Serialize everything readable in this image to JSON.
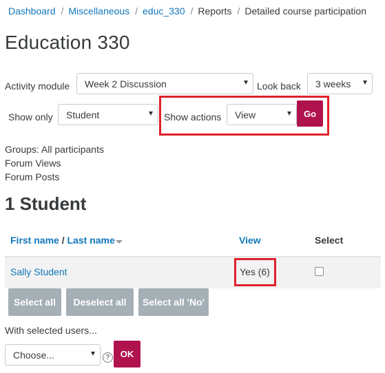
{
  "breadcrumb": {
    "items": [
      "Dashboard",
      "Miscellaneous",
      "educ_330",
      "Reports",
      "Detailed course participation"
    ],
    "separator": "/"
  },
  "page_title": "Education 330",
  "filters": {
    "activity_module_label": "Activity module",
    "activity_module_value": "Week 2 Discussion",
    "look_back_label": "Look back",
    "look_back_value": "3 weeks",
    "show_only_label": "Show only",
    "show_only_value": "Student",
    "show_actions_label": "Show actions",
    "show_actions_value": "View",
    "go_label": "Go"
  },
  "info": {
    "groups": "Groups: All participants",
    "line2": "Forum Views",
    "line3": "Forum Posts"
  },
  "section_heading": "1 Student",
  "table": {
    "col_first_name": "First name",
    "col_slash": " / ",
    "col_last_name": "Last name",
    "col_view": "View",
    "col_select": "Select",
    "rows": [
      {
        "name": "Sally Student",
        "view": "Yes (6)",
        "selected": false
      }
    ]
  },
  "bulk_buttons": {
    "select_all": "Select all",
    "deselect_all": "Deselect all",
    "select_all_no": "Select all 'No'"
  },
  "with_selected": {
    "label": "With selected users...",
    "choose_value": "Choose...",
    "ok_label": "OK"
  },
  "colors": {
    "link": "#1177b9",
    "primary_button": "#b0124e",
    "secondary_button": "#a4afb6",
    "highlight_box": "#e0202b"
  },
  "icons": [
    "sort-descending-icon",
    "help-icon",
    "dropdown-caret-icon"
  ]
}
